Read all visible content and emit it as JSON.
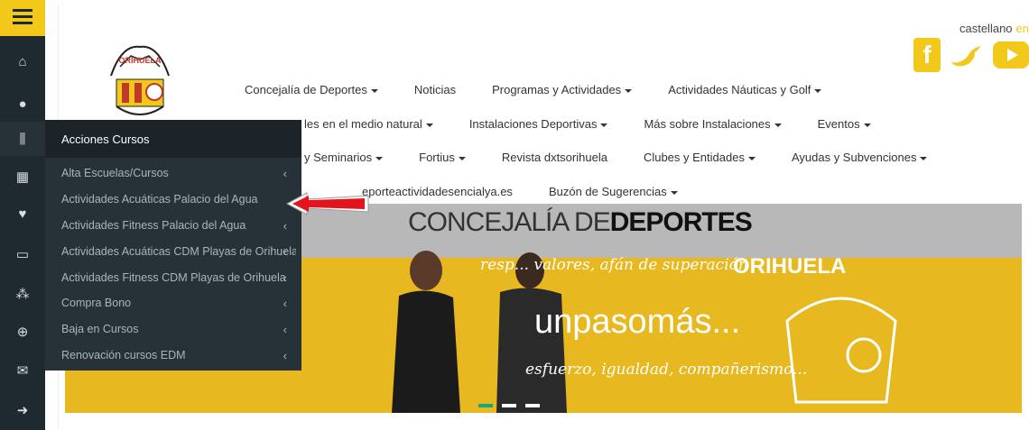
{
  "rail": {
    "items": [
      {
        "icon": "home-icon",
        "glyph": "⌂"
      },
      {
        "icon": "user-icon",
        "glyph": "●"
      },
      {
        "icon": "dumbbell-icon",
        "glyph": "⫼"
      },
      {
        "icon": "calendar-icon",
        "glyph": "▦"
      },
      {
        "icon": "heart-pulse-icon",
        "glyph": "♥"
      },
      {
        "icon": "card-icon",
        "glyph": "▭"
      },
      {
        "icon": "group-icon",
        "glyph": "⁂"
      },
      {
        "icon": "zoom-icon",
        "glyph": "⊕"
      },
      {
        "icon": "mail-icon",
        "glyph": "✉"
      },
      {
        "icon": "logout-icon",
        "glyph": "➜"
      }
    ]
  },
  "header": {
    "lang_current": "castellano",
    "lang_other": "en",
    "social": {
      "facebook": "f",
      "twitter": "🐦"
    }
  },
  "nav": {
    "row1": [
      "Concejalía de Deportes",
      "Noticias",
      "Programas y Actividades",
      "Actividades Náuticas y Golf"
    ],
    "row2": [
      "les en el medio natural",
      "Instalaciones Deportivas",
      "Más sobre Instalaciones",
      "Eventos"
    ],
    "row3": [
      "y Seminarios",
      "Fortius",
      "Revista dxtsorihuela",
      "Clubes y Entidades",
      "Ayudas y Subvenciones"
    ],
    "row4": [
      "eporteactividadesencialya.es",
      "Buzón de Sugerencias"
    ]
  },
  "banner": {
    "title_light": "CONCEJALÍA DE",
    "title_bold": "DEPORTES",
    "script1": "resp... valores, afán de superación",
    "script2": "unpasomás...",
    "script3": "esfuerzo, igualdad, compañerismo...",
    "brand": "ORIHUELA"
  },
  "submenu": {
    "title": "Acciones Cursos",
    "items": [
      {
        "label": "Alta Escuelas/Cursos"
      },
      {
        "label": "Actividades Acuáticas Palacio del Agua"
      },
      {
        "label": "Actividades Fitness Palacio del Agua"
      },
      {
        "label": "Actividades Acuáticas CDM Playas de Orihuela"
      },
      {
        "label": "Actividades Fitness CDM Playas de Orihuela"
      },
      {
        "label": "Compra Bono"
      },
      {
        "label": "Baja en Cursos"
      },
      {
        "label": "Renovación cursos EDM"
      }
    ]
  },
  "colors": {
    "accent": "#f2c81b",
    "sidebar": "#1f2a30",
    "submenu": "#263238",
    "arrow": "#e3141b"
  }
}
